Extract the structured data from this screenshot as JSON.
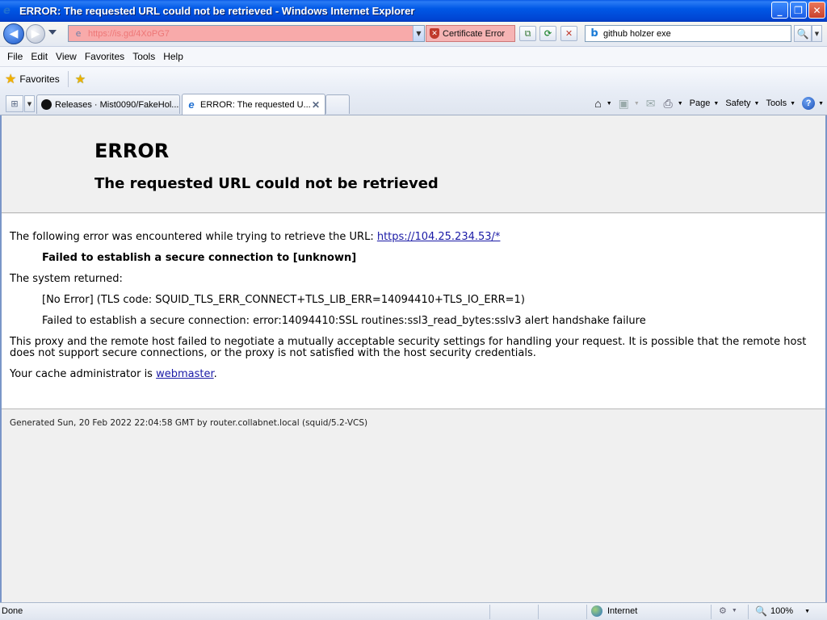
{
  "window": {
    "title": "ERROR: The requested URL could not be retrieved - Windows Internet Explorer",
    "minimize": "_",
    "maximize": "❐",
    "close": "✕"
  },
  "address_bar": {
    "url": "https://is.gd/4XoPG7",
    "certificate_error": "Certificate Error",
    "background_color": "#f8aaaa"
  },
  "search": {
    "value": "github holzer exe",
    "icon": "bing-icon"
  },
  "menu": {
    "items": [
      "File",
      "Edit",
      "View",
      "Favorites",
      "Tools",
      "Help"
    ]
  },
  "favorites_bar": {
    "label": "Favorites"
  },
  "tabs": [
    {
      "label": "Releases · Mist0090/FakeHol...",
      "icon": "github-icon",
      "active": false
    },
    {
      "label": "ERROR: The requested U...",
      "icon": "ie-icon",
      "active": true
    }
  ],
  "command_bar": {
    "page": "Page",
    "safety": "Safety",
    "tools": "Tools"
  },
  "page": {
    "h1": "ERROR",
    "h2": "The requested URL could not be retrieved",
    "intro": "The following error was encountered while trying to retrieve the URL: ",
    "intro_link": "https://104.25.234.53/*",
    "failed_secure": "Failed to establish a secure connection to [unknown]",
    "system_returned": "The system returned:",
    "tls_code": "[No Error] (TLS code: SQUID_TLS_ERR_CONNECT+TLS_LIB_ERR=14094410+TLS_IO_ERR=1)",
    "ssl_error": "Failed to establish a secure connection: error:14094410:SSL routines:ssl3_read_bytes:sslv3 alert handshake failure",
    "explanation": "This proxy and the remote host failed to negotiate a mutually acceptable security settings for handling your request. It is possible that the remote host does not support secure connections, or the proxy is not satisfied with the host security credentials.",
    "admin_prefix": "Your cache administrator is ",
    "admin_link": "webmaster",
    "admin_suffix": ".",
    "footer": "Generated Sun, 20 Feb 2022 22:04:58 GMT by router.collabnet.local (squid/5.2-VCS)"
  },
  "status_bar": {
    "status": "Done",
    "zone": "Internet",
    "zoom": "100%"
  }
}
